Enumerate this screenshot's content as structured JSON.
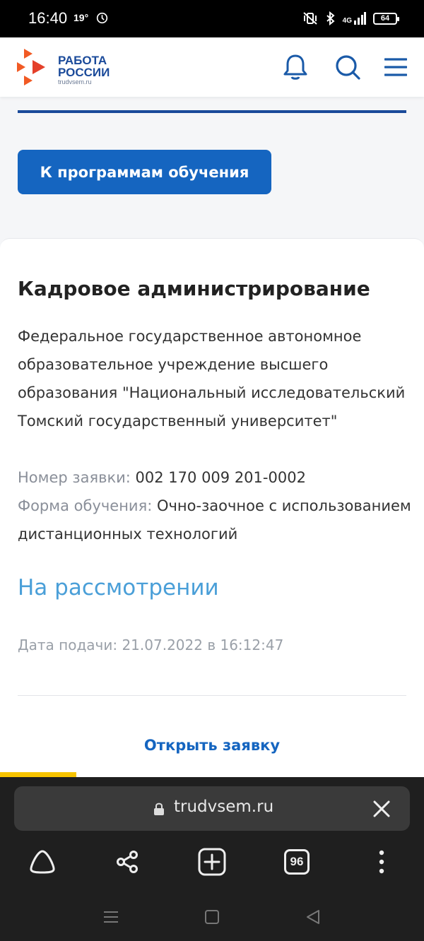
{
  "status_bar": {
    "time": "16:40",
    "temperature": "19°",
    "network": "4G",
    "battery": "64"
  },
  "header": {
    "logo_line1": "РАБОТА",
    "logo_line2": "РОССИИ",
    "logo_domain": "trudvsem.ru",
    "icons": [
      "bell-icon",
      "search-icon",
      "menu-icon"
    ]
  },
  "programs_button": "К программам обучения",
  "card": {
    "title": "Кадровое администрирование",
    "organization": "Федеральное государственное автономное образовательное учреждение высшего образования \"Национальный исследовательский Томский государственный университет\"",
    "application_label": "Номер заявки:",
    "application_value": "002 170 009 201-0002",
    "study_form_label": "Форма обучения:",
    "study_form_value": "Очно-заочное с использованием дистанционных технологий",
    "status": "На рассмотрении",
    "submit_date": "Дата подачи: 21.07.2022 в 16:12:47",
    "open_link": "Открыть заявку"
  },
  "browser": {
    "url": "trudvsem.ru",
    "tabs_count": "96"
  },
  "colors": {
    "brand_blue": "#1565c0",
    "status_blue": "#4a9fd8",
    "logo_orange": "#f15a24",
    "progress_yellow": "#f7c400"
  }
}
